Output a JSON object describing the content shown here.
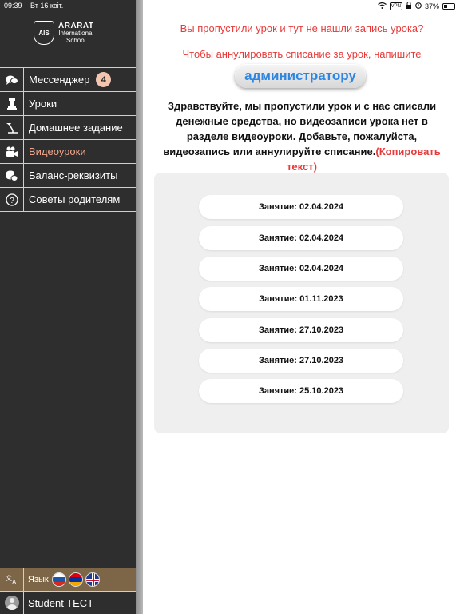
{
  "status": {
    "time": "09:39",
    "date": "Вт 16 квіт.",
    "vpn": "VPN",
    "battery": "37%",
    "battery_level": 0.37
  },
  "logo": {
    "line1": "ARARAT",
    "line2": "International",
    "line3": "School"
  },
  "sidebar": {
    "items": [
      {
        "label": "Мессенджер",
        "icon": "chat-bubbles-icon",
        "badge": "4"
      },
      {
        "label": "Уроки",
        "icon": "chess-piece-icon"
      },
      {
        "label": "Домашнее задание",
        "icon": "desk-lamp-icon"
      },
      {
        "label": "Видеоуроки",
        "icon": "video-camera-icon",
        "active": true
      },
      {
        "label": "Баланс-реквизиты",
        "icon": "coins-icon"
      },
      {
        "label": "Советы родителям",
        "icon": "question-circle-icon"
      }
    ],
    "language": {
      "label": "Язык",
      "icon": "translate-icon",
      "flags": [
        "russia-flag-icon",
        "armenia-flag-icon",
        "uk-flag-icon"
      ]
    },
    "user": {
      "name": "Student TECT",
      "icon": "user-avatar-icon"
    }
  },
  "main": {
    "warning_line1": "Вы пропустили урок и тут не нашли запись урока?",
    "warning_line2": "Чтобы аннулировать списание за урок, напишите",
    "admin_button": "администратору",
    "message": "Здравствуйте, мы пропустили урок и с нас списали денежные средства, но видеозаписи урока нет в разделе видеоуроки. Добавьте, пожалуйста, видеозапись или аннулируйте списание.",
    "copy_link": "(Копировать текст)",
    "lessons": [
      "Занятие: 02.04.2024",
      "Занятие: 02.04.2024",
      "Занятие: 02.04.2024",
      "Занятие: 01.11.2023",
      "Занятие: 27.10.2023",
      "Занятие: 27.10.2023",
      "Занятие: 25.10.2023"
    ]
  },
  "colors": {
    "sidebar_bg": "#2e2e2e",
    "accent_red": "#e83a3a",
    "link_blue": "#2f86e0",
    "active_item": "#f0a58a",
    "language_row_bg": "#7d6647"
  }
}
